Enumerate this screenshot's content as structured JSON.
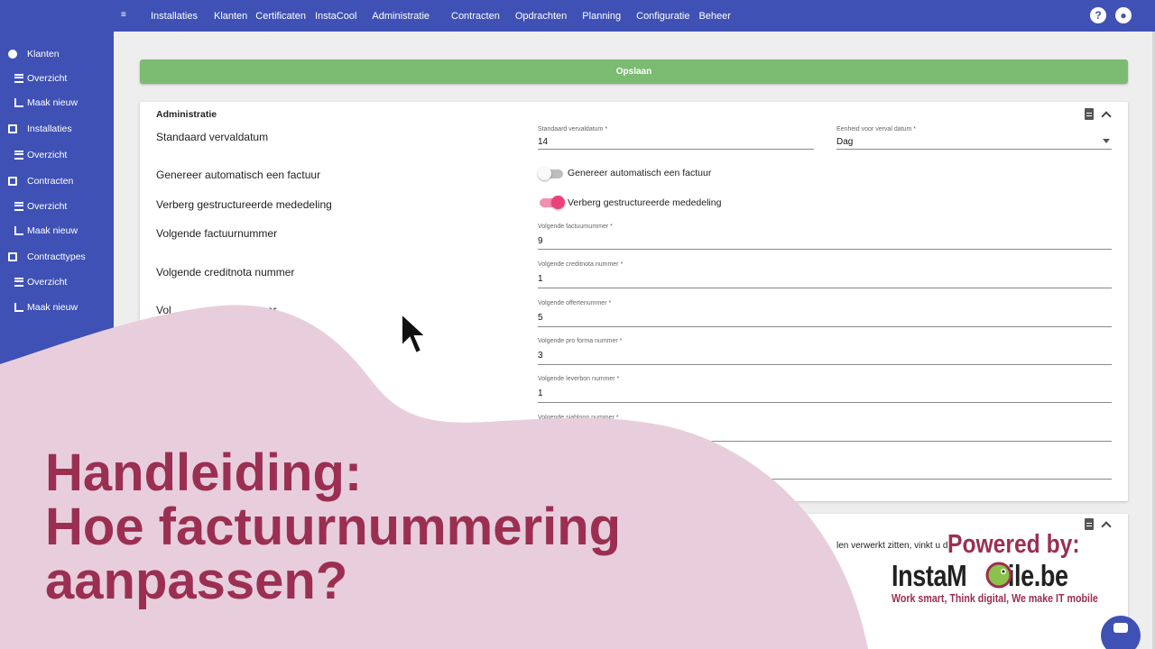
{
  "nav": {
    "items": [
      "Installaties",
      "Klanten",
      "Certificaten",
      "InstaCool",
      "Administratie",
      "Contracten",
      "Opdrachten",
      "Planning",
      "Configuratie",
      "Beheer"
    ],
    "help_icon": "help-icon",
    "account_icon": "account-icon"
  },
  "sidebar": {
    "items": [
      {
        "label": "Klanten",
        "icon": "person-icon"
      },
      {
        "label": "Overzicht",
        "icon": "list-icon"
      },
      {
        "label": "Maak nieuw",
        "icon": "edit-icon"
      },
      {
        "label": "Installaties",
        "icon": "grid-icon"
      },
      {
        "label": "Overzicht",
        "icon": "list-icon"
      },
      {
        "label": "Contracten",
        "icon": "clipboard-icon"
      },
      {
        "label": "Overzicht",
        "icon": "list-icon"
      },
      {
        "label": "Maak nieuw",
        "icon": "edit-icon"
      },
      {
        "label": "Contracttypes",
        "icon": "document-icon"
      },
      {
        "label": "Overzicht",
        "icon": "list-icon"
      },
      {
        "label": "Maak nieuw",
        "icon": "edit-icon"
      }
    ]
  },
  "save_label": "Opslaan",
  "card": {
    "title": "Administratie",
    "rows": {
      "vervaldatum": "Standaard vervaldatum",
      "factuur_auto": "Genereer automatisch een factuur",
      "verberg": "Verberg gestructureerde mededeling",
      "factuurnummer": "Volgende factuurnummer",
      "creditnota": "Volgende creditnota nummer",
      "offerte_partial": "Vol",
      "offerte_partial_end": "mmer"
    },
    "fields": {
      "vervaldatum": {
        "label": "Standaard vervaldatum *",
        "value": "14"
      },
      "eenheid": {
        "label": "Eenheid voor verval datum *",
        "value": "Dag"
      },
      "factuurnummer": {
        "label": "Volgende factuurnummer *",
        "value": "9"
      },
      "creditnota": {
        "label": "Volgende creditnota nummer *",
        "value": "1"
      },
      "offertenummer": {
        "label": "Volgende offertenummer *",
        "value": "5"
      },
      "proforma": {
        "label": "Volgende pro forma nummer *",
        "value": "3"
      },
      "leverbon": {
        "label": "Volgende leverbon nummer *",
        "value": "1"
      },
      "sjabloon": {
        "label": "Volgende sjabloon nummer *",
        "value": ""
      }
    },
    "toggles": {
      "factuur_auto": {
        "label": "Genereer automatisch een factuur",
        "on": false
      },
      "verberg": {
        "label": "Verberg gestructureerde mededeling",
        "on": true
      }
    }
  },
  "card2": {
    "text": "len verwerkt zitten, vinkt u d"
  },
  "overlay": {
    "line1": "Handleiding:",
    "line2": "Hoe factuurnummering",
    "line3": "aanpassen?"
  },
  "branding": {
    "powered": "Powered by:",
    "brand_left": "InstaM",
    "brand_right": "bile.be",
    "tagline": "Work smart, Think digital, We make IT mobile"
  },
  "colors": {
    "primary": "#3f51b5",
    "save": "#7cbb72",
    "overlay": "#e8cedc",
    "headline": "#9b2f52",
    "toggle_on": "#ec407a"
  }
}
